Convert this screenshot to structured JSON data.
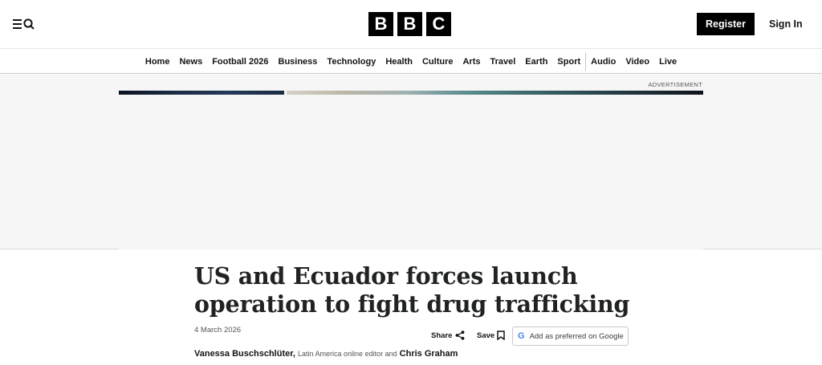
{
  "header": {
    "menu_icon": "menu-search-icon",
    "logo_letters": [
      "B",
      "B",
      "C"
    ],
    "register_label": "Register",
    "signin_label": "Sign In"
  },
  "nav": {
    "items": [
      "Home",
      "News",
      "Football 2026",
      "Business",
      "Technology",
      "Health",
      "Culture",
      "Arts",
      "Travel",
      "Earth",
      "Sport"
    ],
    "items_after_divider": [
      "Audio",
      "Video",
      "Live"
    ]
  },
  "ad": {
    "label": "ADVERTISEMENT"
  },
  "article": {
    "headline": "US and Ecuador forces launch operation to fight drug trafficking",
    "date": "4 March 2026",
    "share_label": "Share",
    "save_label": "Save",
    "google_label": "Add as preferred on Google",
    "byline": {
      "author1": "Vanessa Buschschlüter,",
      "author1_role": "Latin America online editor and",
      "author2": "Chris Graham"
    }
  }
}
